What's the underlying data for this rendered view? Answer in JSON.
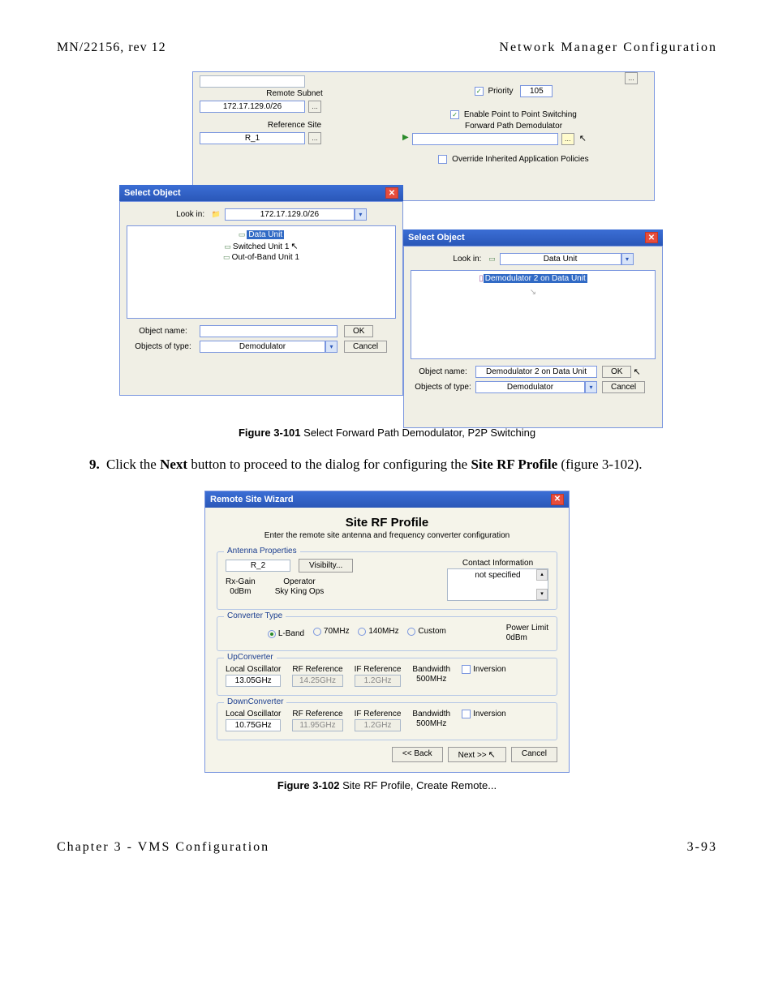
{
  "header": {
    "left": "MN/22156, rev 12",
    "right": "Network Manager Configuration"
  },
  "footer": {
    "left": "Chapter 3 - VMS Configuration",
    "right": "3-93"
  },
  "body": {
    "step_num": "9.",
    "step_pre": " Click the ",
    "step_bold1": "Next",
    "step_mid": " button to proceed to the dialog for configuring the ",
    "step_bold2": "Site RF Profile",
    "step_post": " (figure 3-102)."
  },
  "fig1": {
    "caption_num": "Figure 3-101",
    "caption_text": "   Select Forward Path Demodulator, P2P Switching",
    "back": {
      "remote_subnet_label": "Remote Subnet",
      "remote_subnet_value": "172.17.129.0/26",
      "reference_site_label": "Reference Site",
      "reference_site_value": "R_1",
      "priority_label": "Priority",
      "priority_value": "105",
      "enable_p2p": "Enable Point to Point Switching",
      "fwd_path_label": "Forward Path Demodulator",
      "override_label": "Override Inherited Application Policies"
    },
    "sel_left": {
      "title": "Select Object",
      "lookin_label": "Look in:",
      "lookin_value": "172.17.129.0/26",
      "items": [
        "Data Unit",
        "Switched Unit 1",
        "Out-of-Band Unit 1"
      ],
      "object_name_label": "Object name:",
      "object_name_value": "",
      "objects_type_label": "Objects of type:",
      "objects_type_value": "Demodulator",
      "ok": "OK",
      "cancel": "Cancel"
    },
    "sel_right": {
      "title": "Select Object",
      "lookin_label": "Look in:",
      "lookin_value": "Data Unit",
      "item": "Demodulator 2 on Data Unit",
      "object_name_label": "Object name:",
      "object_name_value": "Demodulator 2 on Data Unit",
      "objects_type_label": "Objects of type:",
      "objects_type_value": "Demodulator",
      "ok": "OK",
      "cancel": "Cancel"
    }
  },
  "fig2": {
    "caption_num": "Figure 3-102",
    "caption_text": "   Site RF Profile, Create Remote...",
    "title_bar": "Remote Site Wizard",
    "heading": "Site RF Profile",
    "subtitle": "Enter the remote site antenna and frequency converter configuration",
    "antenna": {
      "group": "Antenna Properties",
      "name": "R_2",
      "visibility_btn": "Visibilty...",
      "rxgain_label": "Rx-Gain",
      "rxgain_value": "0dBm",
      "operator_label": "Operator",
      "operator_value": "Sky King Ops",
      "contact_label": "Contact Information",
      "contact_value": "not specified"
    },
    "converter_type": {
      "group": "Converter Type",
      "opt1": "L-Band",
      "opt2": "70MHz",
      "opt3": "140MHz",
      "opt4": "Custom",
      "power_limit_label": "Power Limit",
      "power_limit_value": "0dBm"
    },
    "upconv": {
      "group": "UpConverter",
      "lo_label": "Local Oscillator",
      "lo_value": "13.05GHz",
      "rf_label": "RF Reference",
      "rf_value": "14.25GHz",
      "if_label": "IF Reference",
      "if_value": "1.2GHz",
      "bw_label": "Bandwidth",
      "bw_value": "500MHz",
      "inv_label": "Inversion"
    },
    "downconv": {
      "group": "DownConverter",
      "lo_label": "Local Oscillator",
      "lo_value": "10.75GHz",
      "rf_label": "RF Reference",
      "rf_value": "11.95GHz",
      "if_label": "IF Reference",
      "if_value": "1.2GHz",
      "bw_label": "Bandwidth",
      "bw_value": "500MHz",
      "inv_label": "Inversion"
    },
    "buttons": {
      "back": "<< Back",
      "next": "Next >>",
      "cancel": "Cancel"
    }
  }
}
